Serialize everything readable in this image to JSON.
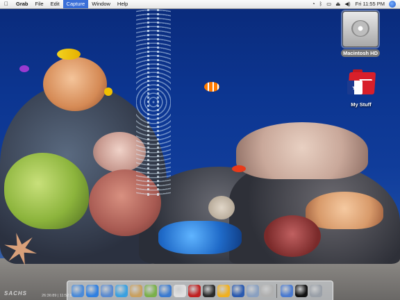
{
  "menubar": {
    "apple": "",
    "app_name": "Grab",
    "items": [
      "File",
      "Edit",
      "Capture",
      "Window",
      "Help"
    ],
    "active_item": "Capture",
    "clock": "Fri 11:55 PM"
  },
  "desktop_icons": [
    {
      "label": "Macintosh HD",
      "icon": "hard-drive-icon"
    },
    {
      "label": "My Stuff",
      "icon": "red-folder-icon"
    }
  ],
  "wallpaper": {
    "logo": "SACHS",
    "timestamp": "26:36:89 | 11:52:8"
  },
  "dock": {
    "items": [
      {
        "icon": "finder-icon",
        "color": "#4a8ad8"
      },
      {
        "icon": "safari-icon",
        "color": "#2f7fe0"
      },
      {
        "icon": "mail-icon",
        "color": "#5a8ad0"
      },
      {
        "icon": "ichat-icon",
        "color": "#3aa0e0"
      },
      {
        "icon": "address-book-icon",
        "color": "#c8a060"
      },
      {
        "icon": "itunes-icon",
        "color": "#7ab04a"
      },
      {
        "icon": "iphoto-icon",
        "color": "#3a7ad0"
      },
      {
        "icon": "imovie-icon",
        "color": "#e0e0e0"
      },
      {
        "icon": "garageband-icon",
        "color": "#c02020"
      },
      {
        "icon": "dashboard-icon",
        "color": "#2a2a2a"
      },
      {
        "icon": "chess-icon",
        "color": "#f0b020"
      },
      {
        "icon": "system-preferences-icon",
        "color": "#2a5ab0"
      },
      {
        "icon": "network-icon",
        "color": "#8aa0c0"
      },
      {
        "icon": "preview-icon",
        "color": "#b0b0b0"
      },
      {
        "icon": "help-icon",
        "color": "#4a7ad0"
      },
      {
        "icon": "terminal-icon",
        "color": "#111111"
      },
      {
        "icon": "trash-icon",
        "color": "#9aa0a8"
      }
    ]
  }
}
